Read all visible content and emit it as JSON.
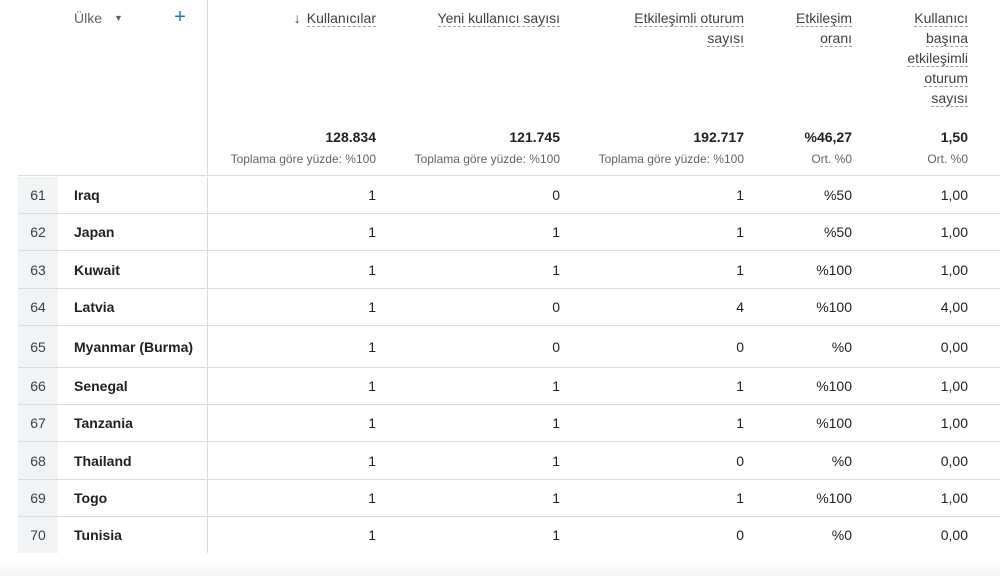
{
  "dimension": {
    "label": "Ülke",
    "add_label": "+"
  },
  "metrics": [
    {
      "title_lines": [
        "Kullanıcılar"
      ],
      "sorted": true,
      "total": "128.834",
      "total_sub": "Toplama göre yüzde: %100"
    },
    {
      "title_lines": [
        "Yeni kullanıcı sayısı"
      ],
      "sorted": false,
      "total": "121.745",
      "total_sub": "Toplama göre yüzde: %100"
    },
    {
      "title_lines": [
        "Etkileşimli oturum",
        "sayısı"
      ],
      "sorted": false,
      "total": "192.717",
      "total_sub": "Toplama göre yüzde: %100"
    },
    {
      "title_lines": [
        "Etkileşim",
        "oranı"
      ],
      "sorted": false,
      "total": "%46,27",
      "total_sub": "Ort. %0"
    },
    {
      "title_lines": [
        "Kullanıcı",
        "başına",
        "etkileşimli",
        "oturum",
        "sayısı"
      ],
      "sorted": false,
      "total": "1,50",
      "total_sub": "Ort. %0"
    }
  ],
  "icons": {
    "sort": "arrow-down-icon",
    "dropdown": "caret-down-icon",
    "add": "plus-icon"
  },
  "colors": {
    "accent": "#1a73e8",
    "index_bg": "#f1f3f4",
    "border": "#dadce0"
  },
  "rows": [
    {
      "index": "61",
      "country": "Iraq",
      "values": [
        "1",
        "0",
        "1",
        "%50",
        "1,00"
      ]
    },
    {
      "index": "62",
      "country": "Japan",
      "values": [
        "1",
        "1",
        "1",
        "%50",
        "1,00"
      ]
    },
    {
      "index": "63",
      "country": "Kuwait",
      "values": [
        "1",
        "1",
        "1",
        "%100",
        "1,00"
      ]
    },
    {
      "index": "64",
      "country": "Latvia",
      "values": [
        "1",
        "0",
        "4",
        "%100",
        "4,00"
      ]
    },
    {
      "index": "65",
      "country": "Myanmar (Burma)",
      "values": [
        "1",
        "0",
        "0",
        "%0",
        "0,00"
      ]
    },
    {
      "index": "66",
      "country": "Senegal",
      "values": [
        "1",
        "1",
        "1",
        "%100",
        "1,00"
      ]
    },
    {
      "index": "67",
      "country": "Tanzania",
      "values": [
        "1",
        "1",
        "1",
        "%100",
        "1,00"
      ]
    },
    {
      "index": "68",
      "country": "Thailand",
      "values": [
        "1",
        "1",
        "0",
        "%0",
        "0,00"
      ]
    },
    {
      "index": "69",
      "country": "Togo",
      "values": [
        "1",
        "1",
        "1",
        "%100",
        "1,00"
      ]
    },
    {
      "index": "70",
      "country": "Tunisia",
      "values": [
        "1",
        "1",
        "0",
        "%0",
        "0,00"
      ]
    }
  ]
}
